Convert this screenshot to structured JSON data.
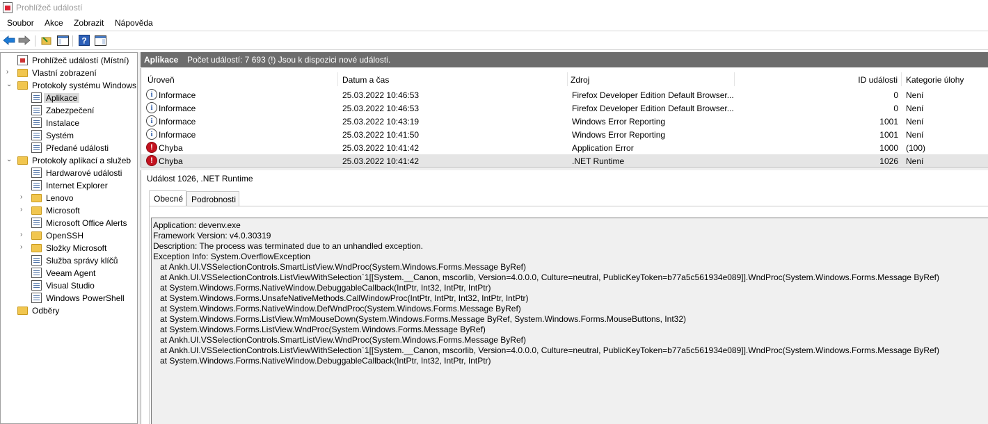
{
  "window": {
    "title": "Prohlížeč událostí"
  },
  "menu": [
    "Soubor",
    "Akce",
    "Zobrazit",
    "Nápověda"
  ],
  "toolbar": {
    "buttons": [
      "back-icon",
      "forward-icon",
      "open-folder-icon",
      "show-hide-tree-icon",
      "help-icon",
      "action-pane-icon"
    ]
  },
  "tree": {
    "items": [
      {
        "label": "Prohlížeč událostí (Místní)",
        "icon": "event-viewer-icon",
        "level": 0,
        "expander": ""
      },
      {
        "label": "Vlastní zobrazení",
        "icon": "folder-icon",
        "level": 0,
        "expander": "›"
      },
      {
        "label": "Protokoly systému Windows",
        "icon": "folder-icon",
        "level": 0,
        "expander": "⌄"
      },
      {
        "label": "Aplikace",
        "icon": "log-icon",
        "level": 1,
        "expander": "",
        "selected": true
      },
      {
        "label": "Zabezpečení",
        "icon": "log-icon",
        "level": 1,
        "expander": ""
      },
      {
        "label": "Instalace",
        "icon": "log-icon",
        "level": 1,
        "expander": ""
      },
      {
        "label": "Systém",
        "icon": "log-icon",
        "level": 1,
        "expander": ""
      },
      {
        "label": "Předané události",
        "icon": "log-icon",
        "level": 1,
        "expander": ""
      },
      {
        "label": "Protokoly aplikací a služeb",
        "icon": "folder-icon",
        "level": 0,
        "expander": "⌄"
      },
      {
        "label": "Hardwarové události",
        "icon": "log-icon",
        "level": 1,
        "expander": ""
      },
      {
        "label": "Internet Explorer",
        "icon": "log-icon",
        "level": 1,
        "expander": ""
      },
      {
        "label": "Lenovo",
        "icon": "folder-icon",
        "level": 1,
        "expander": "›"
      },
      {
        "label": "Microsoft",
        "icon": "folder-icon",
        "level": 1,
        "expander": "›"
      },
      {
        "label": "Microsoft Office Alerts",
        "icon": "log-icon",
        "level": 1,
        "expander": ""
      },
      {
        "label": "OpenSSH",
        "icon": "folder-icon",
        "level": 1,
        "expander": "›"
      },
      {
        "label": "Složky Microsoft",
        "icon": "folder-icon",
        "level": 1,
        "expander": "›"
      },
      {
        "label": "Služba správy klíčů",
        "icon": "log-icon",
        "level": 1,
        "expander": ""
      },
      {
        "label": "Veeam Agent",
        "icon": "log-icon",
        "level": 1,
        "expander": ""
      },
      {
        "label": "Visual Studio",
        "icon": "log-icon",
        "level": 1,
        "expander": ""
      },
      {
        "label": "Windows PowerShell",
        "icon": "log-icon",
        "level": 1,
        "expander": ""
      },
      {
        "label": "Odběry",
        "icon": "subscriptions-icon",
        "level": 0,
        "expander": ""
      }
    ]
  },
  "pane": {
    "name": "Aplikace",
    "info": "Počet událostí: 7 693 (!) Jsou k dispozici nové události."
  },
  "grid": {
    "columns": [
      "Úroveň",
      "Datum a čas",
      "Zdroj",
      "ID události",
      "Kategorie úlohy"
    ],
    "rows": [
      {
        "level": "Informace",
        "type": "info",
        "datetime": "25.03.2022 10:46:53",
        "source": "Firefox Developer Edition Default Browser...",
        "id": "0",
        "category": "Není"
      },
      {
        "level": "Informace",
        "type": "info",
        "datetime": "25.03.2022 10:46:53",
        "source": "Firefox Developer Edition Default Browser...",
        "id": "0",
        "category": "Není"
      },
      {
        "level": "Informace",
        "type": "info",
        "datetime": "25.03.2022 10:43:19",
        "source": "Windows Error Reporting",
        "id": "1001",
        "category": "Není"
      },
      {
        "level": "Informace",
        "type": "info",
        "datetime": "25.03.2022 10:41:50",
        "source": "Windows Error Reporting",
        "id": "1001",
        "category": "Není"
      },
      {
        "level": "Chyba",
        "type": "error",
        "datetime": "25.03.2022 10:41:42",
        "source": "Application Error",
        "id": "1000",
        "category": "(100)"
      },
      {
        "level": "Chyba",
        "type": "error",
        "datetime": "25.03.2022 10:41:42",
        "source": ".NET Runtime",
        "id": "1026",
        "category": "Není",
        "selected": true
      }
    ]
  },
  "detail": {
    "title": "Událost 1026, .NET Runtime",
    "tabs": [
      "Obecné",
      "Podrobnosti"
    ],
    "description": [
      "Application: devenv.exe",
      "Framework Version: v4.0.30319",
      "Description: The process was terminated due to an unhandled exception.",
      "Exception Info: System.OverflowException",
      "   at Ankh.UI.VSSelectionControls.SmartListView.WndProc(System.Windows.Forms.Message ByRef)",
      "   at Ankh.UI.VSSelectionControls.ListViewWithSelection`1[[System.__Canon, mscorlib, Version=4.0.0.0, Culture=neutral, PublicKeyToken=b77a5c561934e089]].WndProc(System.Windows.Forms.Message ByRef)",
      "   at System.Windows.Forms.NativeWindow.DebuggableCallback(IntPtr, Int32, IntPtr, IntPtr)",
      "   at System.Windows.Forms.UnsafeNativeMethods.CallWindowProc(IntPtr, IntPtr, Int32, IntPtr, IntPtr)",
      "   at System.Windows.Forms.NativeWindow.DefWndProc(System.Windows.Forms.Message ByRef)",
      "   at System.Windows.Forms.ListView.WmMouseDown(System.Windows.Forms.Message ByRef, System.Windows.Forms.MouseButtons, Int32)",
      "   at System.Windows.Forms.ListView.WndProc(System.Windows.Forms.Message ByRef)",
      "   at Ankh.UI.VSSelectionControls.SmartListView.WndProc(System.Windows.Forms.Message ByRef)",
      "   at Ankh.UI.VSSelectionControls.ListViewWithSelection`1[[System.__Canon, mscorlib, Version=4.0.0.0, Culture=neutral, PublicKeyToken=b77a5c561934e089]].WndProc(System.Windows.Forms.Message ByRef)",
      "   at System.Windows.Forms.NativeWindow.DebuggableCallback(IntPtr, Int32, IntPtr, IntPtr)"
    ]
  },
  "colors": {
    "header_bg": "#6d6d6d",
    "selected_row": "#e5e5e5",
    "error": "#c4121f",
    "info": "#2a5aa8"
  }
}
